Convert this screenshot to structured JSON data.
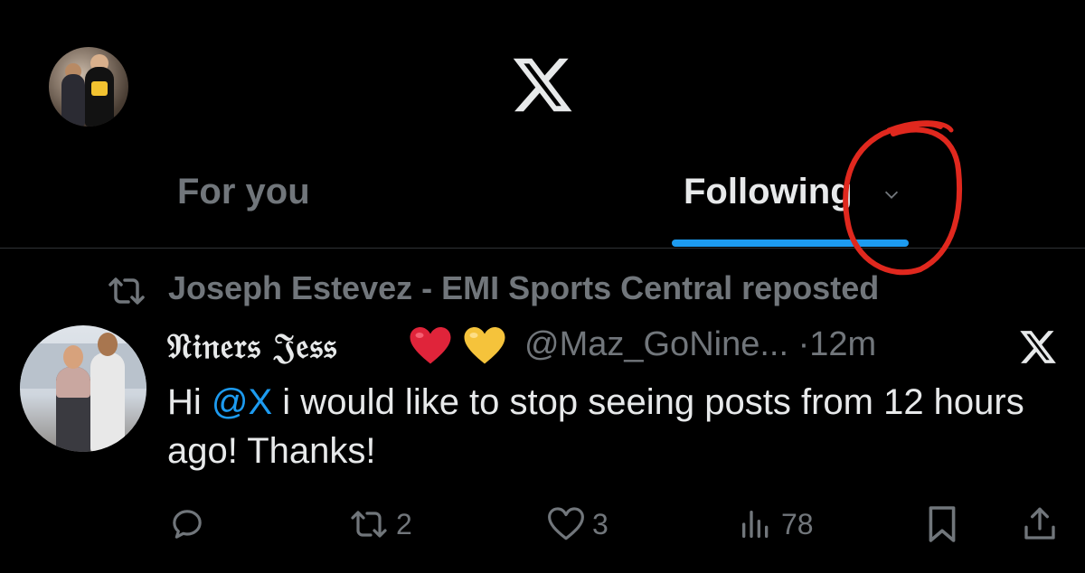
{
  "header": {
    "logo": "x-logo",
    "tabs": [
      {
        "label": "For you",
        "selected": false
      },
      {
        "label": "Following",
        "selected": true
      }
    ],
    "accent_color": "#1d9bf0"
  },
  "repost_banner": {
    "icon": "repost-icon",
    "text": "Joseph Estevez - EMI Sports Central reposted"
  },
  "tweet": {
    "display_name": "𝔑𝔦𝔫𝔢𝔯𝔰 𝔍𝔢𝔰𝔰",
    "emojis": [
      "red-heart",
      "yellow-heart"
    ],
    "handle": "@Maz_GoNine...",
    "separator": "·",
    "time": "12m",
    "text_prefix": "Hi ",
    "mention": "@X",
    "text_suffix": " i would like to stop seeing posts from 12 hours ago! Thanks!",
    "actions": {
      "reply_count": "",
      "repost_count": "2",
      "like_count": "3",
      "views_count": "78"
    }
  },
  "annotation": {
    "color": "#e0281e",
    "shape": "hand-drawn circle"
  }
}
